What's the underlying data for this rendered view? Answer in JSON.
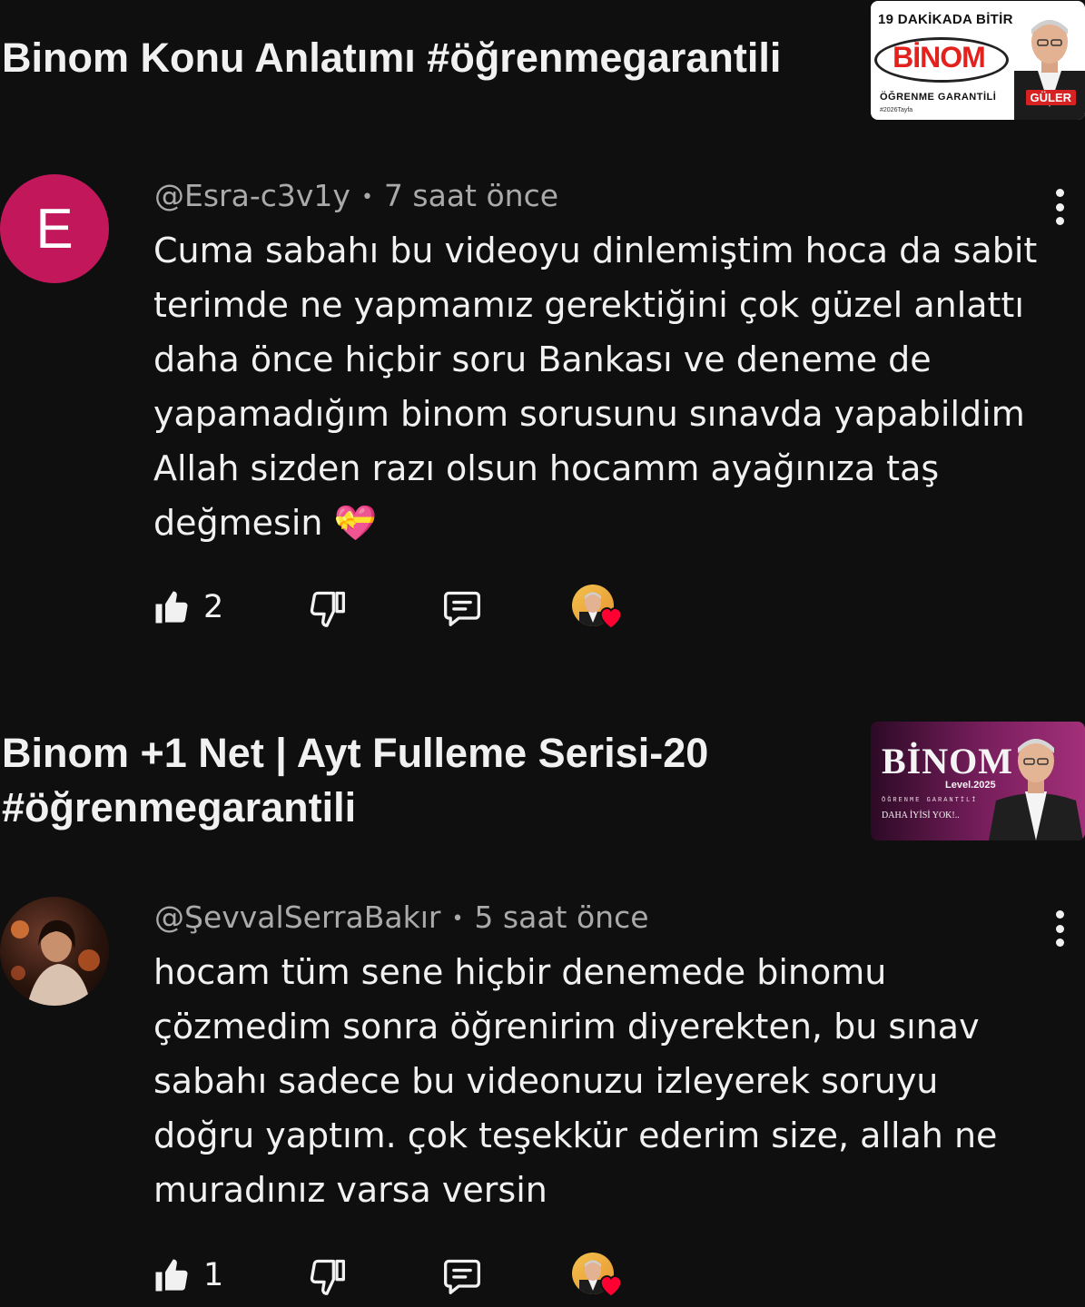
{
  "items": [
    {
      "video": {
        "title": "Binom Konu Anlatımı #öğrenmegarantili",
        "thumbnail": {
          "top_text": "19 DAKİKADA BİTİR",
          "main_text": "BİNOM",
          "sub_text": "ÖĞRENME GARANTİLİ",
          "tag": "#2026Tayfa",
          "name_badge": "GÜLER"
        }
      },
      "comment": {
        "avatar_letter": "E",
        "author": "@Esra-c3v1y",
        "separator": "•",
        "time": "7 saat önce",
        "text": "Cuma sabahı bu videoyu dinlemiştim hoca da sabit terimde ne yapmamız gerektiğini çok güzel anlattı daha önce hiçbir soru Bankası ve deneme de yapamadığım binom sorusunu sınavda yapabildim Allah sizden razı olsun hocamm ayağınıza taş değmesin 💝",
        "like_count": "2"
      }
    },
    {
      "video": {
        "title": "Binom +1 Net | Ayt Fulleme Serisi-20 #öğrenmegarantili",
        "thumbnail": {
          "main_text": "BİNOM",
          "level_text": "Level.2025",
          "sub_text": "ÖĞRENME GARANTİLİ",
          "tag": "DAHA İYİSİ YOK!.."
        }
      },
      "comment": {
        "author": "@ŞevvalSerraBakır",
        "separator": "•",
        "time": "5 saat önce",
        "text": "hocam tüm sene hiçbir denemede binomu çözmedim sonra öğrenirim diyerekten, bu sınav sabahı sadece bu videonuzu izleyerek soruyu doğru yaptım. çok teşekkür ederim size, allah ne muradınız varsa versin",
        "like_count": "1"
      }
    }
  ],
  "icons": {
    "like": "thumbs-up-icon",
    "dislike": "thumbs-down-icon",
    "reply": "reply-icon",
    "creator_heart": "creator-heart-icon",
    "more": "more-vertical-icon"
  },
  "colors": {
    "background": "#0f0f0f",
    "text_primary": "#f1f1f1",
    "text_secondary": "#aaaaaa",
    "avatar_e": "#c2185b",
    "heart": "#ff0033"
  }
}
